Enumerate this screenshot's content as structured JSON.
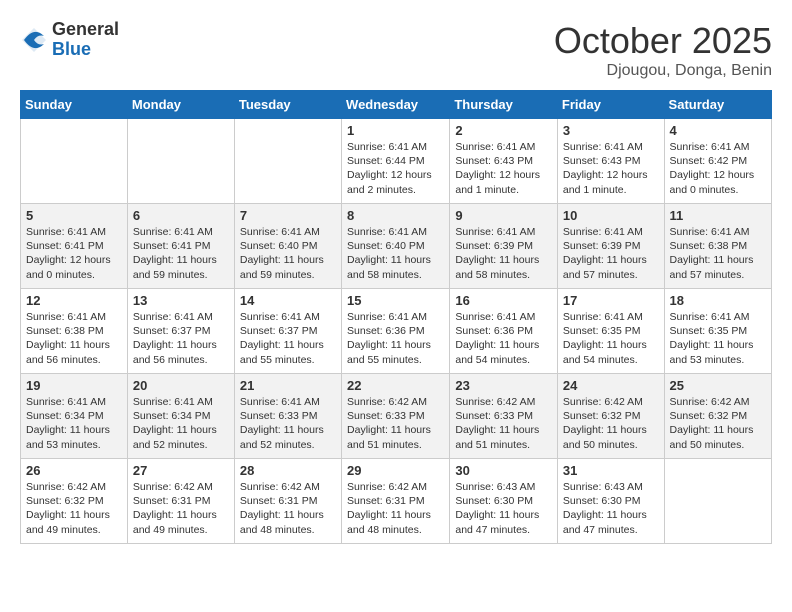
{
  "header": {
    "logo_general": "General",
    "logo_blue": "Blue",
    "month_title": "October 2025",
    "location": "Djougou, Donga, Benin"
  },
  "days_of_week": [
    "Sunday",
    "Monday",
    "Tuesday",
    "Wednesday",
    "Thursday",
    "Friday",
    "Saturday"
  ],
  "weeks": [
    [
      {
        "day": "",
        "info": ""
      },
      {
        "day": "",
        "info": ""
      },
      {
        "day": "",
        "info": ""
      },
      {
        "day": "1",
        "info": "Sunrise: 6:41 AM\nSunset: 6:44 PM\nDaylight: 12 hours and 2 minutes."
      },
      {
        "day": "2",
        "info": "Sunrise: 6:41 AM\nSunset: 6:43 PM\nDaylight: 12 hours and 1 minute."
      },
      {
        "day": "3",
        "info": "Sunrise: 6:41 AM\nSunset: 6:43 PM\nDaylight: 12 hours and 1 minute."
      },
      {
        "day": "4",
        "info": "Sunrise: 6:41 AM\nSunset: 6:42 PM\nDaylight: 12 hours and 0 minutes."
      }
    ],
    [
      {
        "day": "5",
        "info": "Sunrise: 6:41 AM\nSunset: 6:41 PM\nDaylight: 12 hours and 0 minutes."
      },
      {
        "day": "6",
        "info": "Sunrise: 6:41 AM\nSunset: 6:41 PM\nDaylight: 11 hours and 59 minutes."
      },
      {
        "day": "7",
        "info": "Sunrise: 6:41 AM\nSunset: 6:40 PM\nDaylight: 11 hours and 59 minutes."
      },
      {
        "day": "8",
        "info": "Sunrise: 6:41 AM\nSunset: 6:40 PM\nDaylight: 11 hours and 58 minutes."
      },
      {
        "day": "9",
        "info": "Sunrise: 6:41 AM\nSunset: 6:39 PM\nDaylight: 11 hours and 58 minutes."
      },
      {
        "day": "10",
        "info": "Sunrise: 6:41 AM\nSunset: 6:39 PM\nDaylight: 11 hours and 57 minutes."
      },
      {
        "day": "11",
        "info": "Sunrise: 6:41 AM\nSunset: 6:38 PM\nDaylight: 11 hours and 57 minutes."
      }
    ],
    [
      {
        "day": "12",
        "info": "Sunrise: 6:41 AM\nSunset: 6:38 PM\nDaylight: 11 hours and 56 minutes."
      },
      {
        "day": "13",
        "info": "Sunrise: 6:41 AM\nSunset: 6:37 PM\nDaylight: 11 hours and 56 minutes."
      },
      {
        "day": "14",
        "info": "Sunrise: 6:41 AM\nSunset: 6:37 PM\nDaylight: 11 hours and 55 minutes."
      },
      {
        "day": "15",
        "info": "Sunrise: 6:41 AM\nSunset: 6:36 PM\nDaylight: 11 hours and 55 minutes."
      },
      {
        "day": "16",
        "info": "Sunrise: 6:41 AM\nSunset: 6:36 PM\nDaylight: 11 hours and 54 minutes."
      },
      {
        "day": "17",
        "info": "Sunrise: 6:41 AM\nSunset: 6:35 PM\nDaylight: 11 hours and 54 minutes."
      },
      {
        "day": "18",
        "info": "Sunrise: 6:41 AM\nSunset: 6:35 PM\nDaylight: 11 hours and 53 minutes."
      }
    ],
    [
      {
        "day": "19",
        "info": "Sunrise: 6:41 AM\nSunset: 6:34 PM\nDaylight: 11 hours and 53 minutes."
      },
      {
        "day": "20",
        "info": "Sunrise: 6:41 AM\nSunset: 6:34 PM\nDaylight: 11 hours and 52 minutes."
      },
      {
        "day": "21",
        "info": "Sunrise: 6:41 AM\nSunset: 6:33 PM\nDaylight: 11 hours and 52 minutes."
      },
      {
        "day": "22",
        "info": "Sunrise: 6:42 AM\nSunset: 6:33 PM\nDaylight: 11 hours and 51 minutes."
      },
      {
        "day": "23",
        "info": "Sunrise: 6:42 AM\nSunset: 6:33 PM\nDaylight: 11 hours and 51 minutes."
      },
      {
        "day": "24",
        "info": "Sunrise: 6:42 AM\nSunset: 6:32 PM\nDaylight: 11 hours and 50 minutes."
      },
      {
        "day": "25",
        "info": "Sunrise: 6:42 AM\nSunset: 6:32 PM\nDaylight: 11 hours and 50 minutes."
      }
    ],
    [
      {
        "day": "26",
        "info": "Sunrise: 6:42 AM\nSunset: 6:32 PM\nDaylight: 11 hours and 49 minutes."
      },
      {
        "day": "27",
        "info": "Sunrise: 6:42 AM\nSunset: 6:31 PM\nDaylight: 11 hours and 49 minutes."
      },
      {
        "day": "28",
        "info": "Sunrise: 6:42 AM\nSunset: 6:31 PM\nDaylight: 11 hours and 48 minutes."
      },
      {
        "day": "29",
        "info": "Sunrise: 6:42 AM\nSunset: 6:31 PM\nDaylight: 11 hours and 48 minutes."
      },
      {
        "day": "30",
        "info": "Sunrise: 6:43 AM\nSunset: 6:30 PM\nDaylight: 11 hours and 47 minutes."
      },
      {
        "day": "31",
        "info": "Sunrise: 6:43 AM\nSunset: 6:30 PM\nDaylight: 11 hours and 47 minutes."
      },
      {
        "day": "",
        "info": ""
      }
    ]
  ]
}
